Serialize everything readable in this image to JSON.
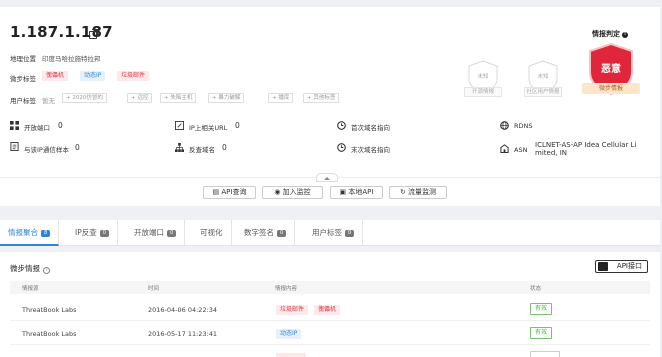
{
  "ip": {
    "address": "1.187.1.187"
  },
  "basic": {
    "location_label": "地理位置",
    "location_value": "印度马哈拉施特拉邦",
    "intel_tags_label": "微步标签",
    "intel_tags": [
      "傀儡机",
      "动态IP",
      "垃圾邮件"
    ],
    "user_tags_label": "用户标签",
    "user_tags_none": "暂无",
    "user_tag_suggestions": [
      "+ 2020仿冒的",
      "+ 远控",
      "+ 失陷主机",
      "+ 暴力破解",
      "+ 播库",
      "+ 其他标签"
    ]
  },
  "verdict": {
    "title": "情报判定",
    "open_source": {
      "status": "未知",
      "label": "开源情报"
    },
    "community": {
      "status": "未知",
      "label": "社区用户情报"
    },
    "threatbook": {
      "status": "恶意",
      "label": "微步情报"
    }
  },
  "stats": [
    {
      "label": "开放端口",
      "value": "0"
    },
    {
      "label": "IP上相关URL",
      "value": "0"
    },
    {
      "label": "首次域名指向",
      "value": ""
    },
    {
      "label": "RDNS",
      "value": ""
    },
    {
      "label": "与该IP通信样本",
      "value": "0"
    },
    {
      "label": "反查域名",
      "value": "0"
    },
    {
      "label": "末次域名指向",
      "value": ""
    },
    {
      "label": "ASN",
      "value": "ICLNET-AS-AP Idea Cellular Li",
      "value2": "mited, IN"
    }
  ],
  "actions": [
    "API查询",
    "加入监控",
    "本地API",
    "流量监测"
  ],
  "tabs": [
    {
      "label": "情报聚合",
      "count": "8"
    },
    {
      "label": "IP反查",
      "count": "0"
    },
    {
      "label": "开放端口",
      "count": "0"
    },
    {
      "label": "可视化",
      "count": ""
    },
    {
      "label": "数字签名",
      "count": "0"
    },
    {
      "label": "用户标签",
      "count": "0"
    }
  ],
  "intel_panel": {
    "title": "微步情报",
    "api_button": "API接口",
    "columns": [
      "情报源",
      "时间",
      "情报内容",
      "状态"
    ],
    "rows": [
      {
        "source": "ThreatBook Labs",
        "time": "2016-04-06 04:22:34",
        "tags": [
          "垃圾邮件",
          "傀儡机"
        ],
        "status": "有效"
      },
      {
        "source": "ThreatBook Labs",
        "time": "2016-05-17 11:23:41",
        "tags": [
          "动态IP"
        ],
        "status": "有效"
      }
    ]
  },
  "colors": {
    "accent": "#2f84d6",
    "danger": "#e0384f",
    "ok": "#52b44b"
  }
}
